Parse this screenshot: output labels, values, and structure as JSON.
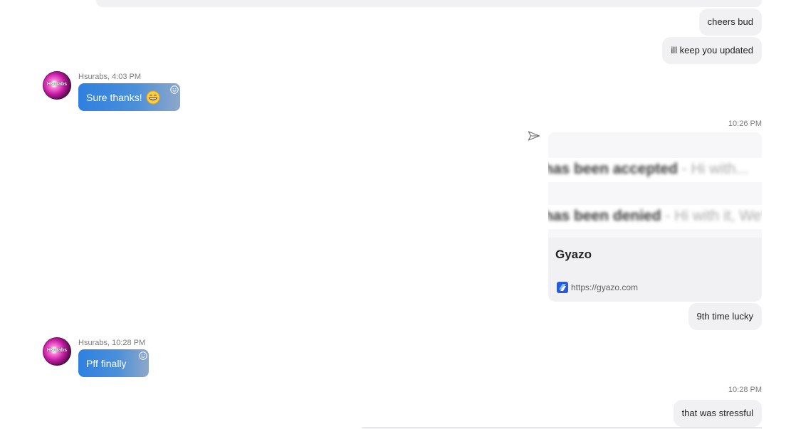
{
  "conversation": {
    "outgoing_1": "cheers bud",
    "outgoing_2": "ill keep you updated",
    "incoming_1": {
      "sender": "Hsurabs",
      "time": "4:03 PM",
      "meta": "Hsurabs, 4:03 PM",
      "text": "Sure thanks!",
      "emoji": "grinning-face-emoji"
    },
    "timestamp_1": "10:26 PM",
    "link_card": {
      "blurred_line_1": "has been accepted",
      "blurred_line_1_suffix": " - Hi with...",
      "blurred_line_2": "has been denied",
      "blurred_line_2_suffix": " - Hi with it, We'...",
      "title": "Gyazo",
      "url": "https://gyazo.com",
      "site_icon": "gyazo-logo-icon"
    },
    "outgoing_3": "9th time lucky",
    "incoming_2": {
      "sender": "Hsurabs",
      "time": "10:28 PM",
      "meta": "Hsurabs, 10:28 PM",
      "text": "Pff finally"
    },
    "timestamp_2": "10:28 PM",
    "outgoing_4": "that was stressful"
  },
  "avatar": {
    "label": "Hsurabs"
  },
  "colors": {
    "incoming_bubble_start": "#2f80e0",
    "incoming_bubble_end": "#8ea7c9",
    "outgoing_bubble": "#f1f1f4",
    "timestamp": "#7a7a7a"
  }
}
